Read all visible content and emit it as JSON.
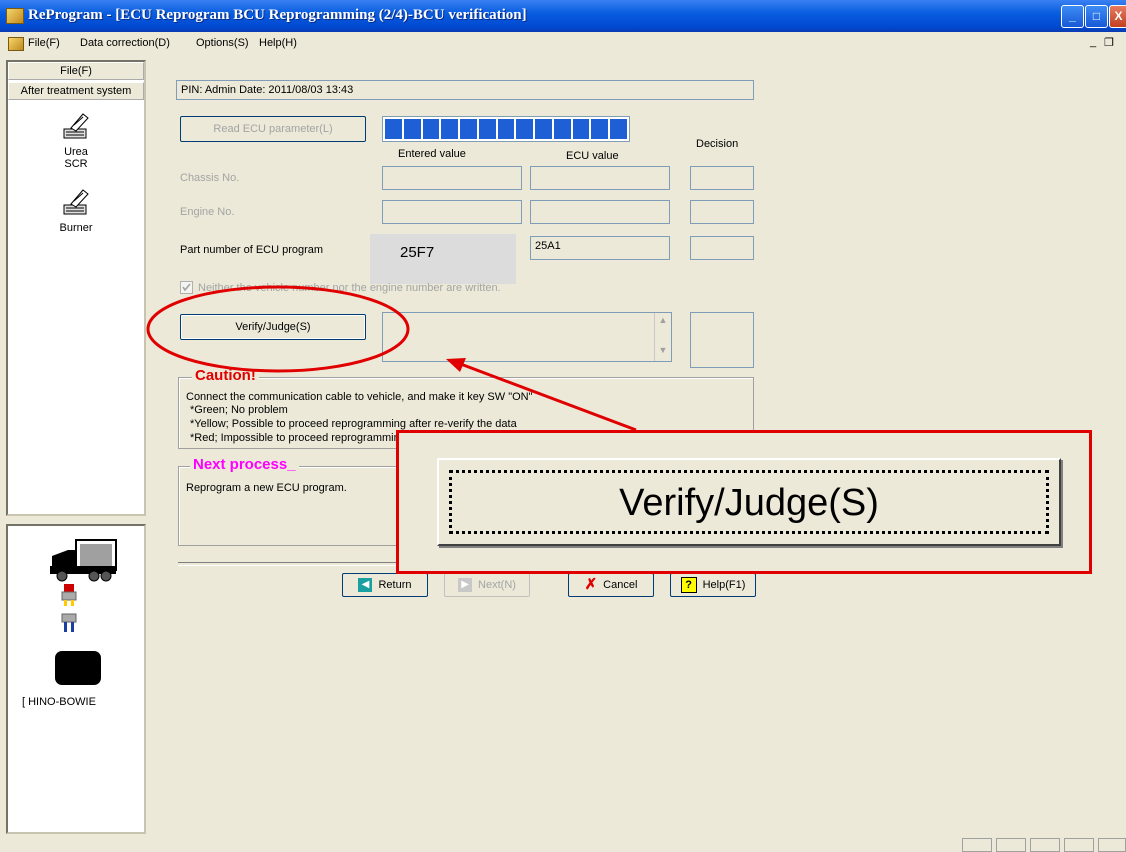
{
  "window": {
    "title": "ReProgram - [ECU Reprogram BCU Reprogramming (2/4)-BCU verification]",
    "controls": {
      "minimize": "_",
      "maximize": "□",
      "close": "X"
    }
  },
  "menu": {
    "items": [
      "File(F)",
      "Data correction(D)",
      "Options(S)",
      "Help(H)"
    ]
  },
  "sidebar": {
    "file_button": "File(F)",
    "category": "After treatment system",
    "tools": [
      {
        "label": "Urea SCR",
        "icon": "urea-scr-icon"
      },
      {
        "label": "Burner",
        "icon": "burner-icon"
      }
    ]
  },
  "device_panel": {
    "label": "[ HINO-BOWIE"
  },
  "main": {
    "pin_date": "PIN: Admin  Date: 2011/08/03 13:43",
    "read_button": "Read ECU parameter(L)",
    "progress": {
      "segments": 13,
      "filled": 13,
      "color": "#1f5fd6"
    },
    "headers": {
      "entered": "Entered value",
      "ecu": "ECU value",
      "decision": "Decision"
    },
    "rows": [
      {
        "label": "Chassis No.",
        "entered": "",
        "ecu": "",
        "decision": ""
      },
      {
        "label": "Engine No.",
        "entered": "",
        "ecu": "",
        "decision": ""
      },
      {
        "label": "Part number of ECU program",
        "entered": "25F7",
        "ecu": "25A1",
        "decision": ""
      }
    ],
    "checkbox_label": "Neither the vehicle number nor the engine number are written.",
    "verify_button": "Verify/Judge(S)",
    "caution": {
      "title": "Caution!",
      "lines": [
        "Connect the communication cable to vehicle, and make it key SW \"ON\"",
        "*Green; No problem",
        "*Yellow; Possible to proceed reprogramming after re-verify the data",
        "*Red; Impossible to proceed reprogramming"
      ]
    },
    "next_process": {
      "title": "Next process_",
      "text": "Reprogram a new ECU program."
    },
    "buttons": {
      "return": "Return",
      "next": "Next(N)",
      "cancel": "Cancel",
      "help": "Help(F1)"
    },
    "zoom_callout": {
      "label": "Verify/Judge(S)"
    }
  },
  "colors": {
    "highlight_red": "#e00000",
    "caption_magenta": "#ff00ff",
    "progress_blue": "#1f5fd6"
  }
}
